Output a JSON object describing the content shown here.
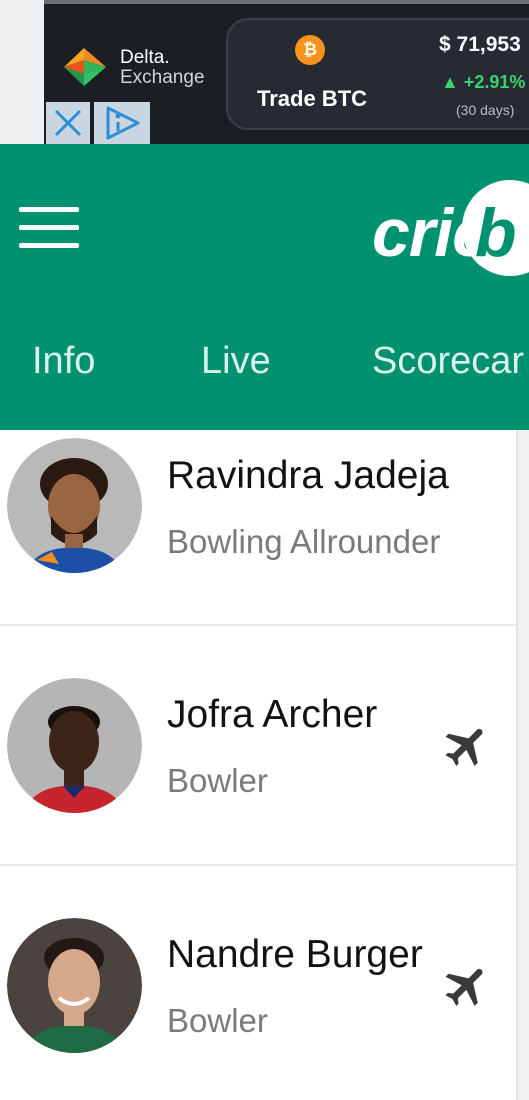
{
  "ad": {
    "brand_line1": "Delta.",
    "brand_line2": "Exchange",
    "coin_symbol": "₿",
    "cta": "Trade BTC",
    "price": "$ 71,953",
    "change": "▲ +2.91%",
    "period": "(30 days)",
    "close_icon": "close-icon",
    "info_icon": "adchoices-icon",
    "colors": {
      "positive": "#3bd16f",
      "bitcoin": "#f7931a"
    }
  },
  "header": {
    "menu_icon": "hamburger-menu-icon",
    "brand_text": "cric",
    "brand_tail": "b",
    "bg_color": "#009270",
    "tabs": [
      {
        "label": "Info"
      },
      {
        "label": "Live"
      },
      {
        "label": "Scorecar"
      }
    ]
  },
  "players": [
    {
      "name": "Ravindra Jadeja",
      "role": "Bowling Allrounder",
      "overseas": false
    },
    {
      "name": "Jofra Archer",
      "role": "Bowler",
      "overseas": true,
      "badge_icon": "airplane-icon"
    },
    {
      "name": "Nandre Burger",
      "role": "Bowler",
      "overseas": true,
      "badge_icon": "airplane-icon"
    }
  ]
}
